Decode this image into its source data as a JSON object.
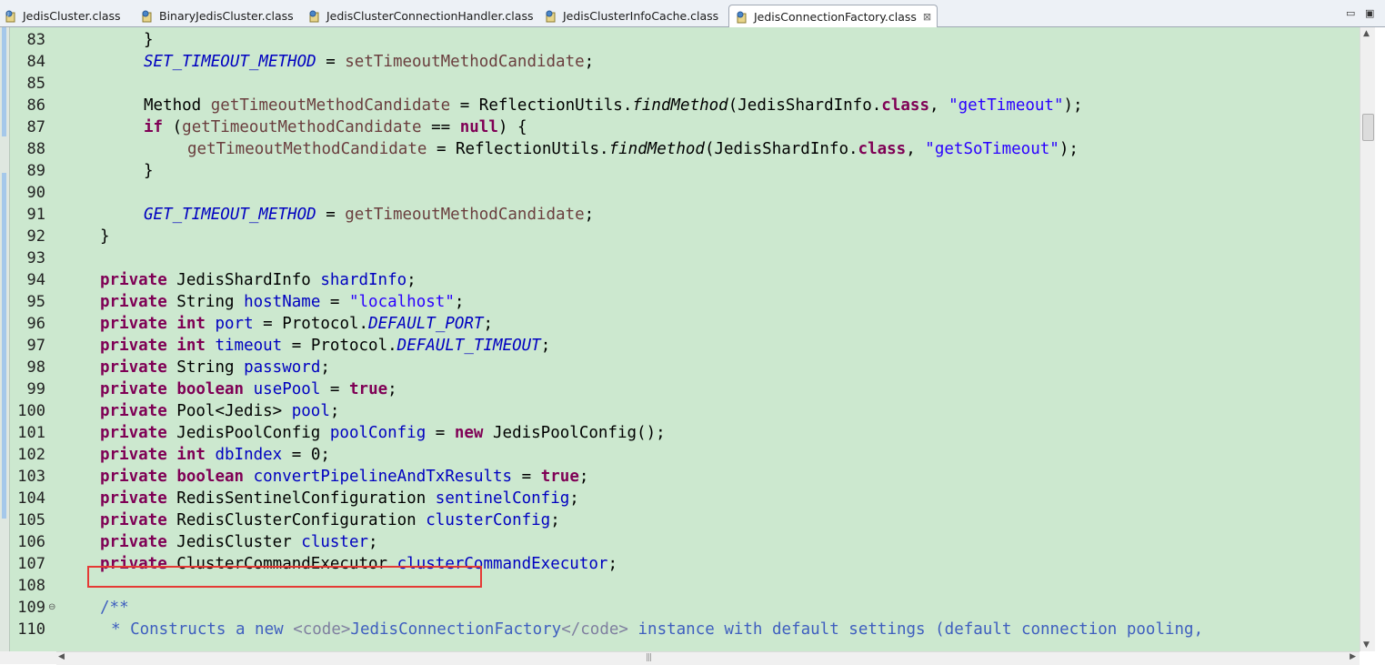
{
  "tabs": [
    {
      "label": "JedisCluster.class",
      "active": false
    },
    {
      "label": "BinaryJedisCluster.class",
      "active": false
    },
    {
      "label": "JedisClusterConnectionHandler.class",
      "active": false
    },
    {
      "label": "JedisClusterInfoCache.class",
      "active": false
    },
    {
      "label": "JedisConnectionFactory.class",
      "active": true
    }
  ],
  "window_controls": {
    "minimize": "▭",
    "maximize": "▣"
  },
  "close_glyph": "⊠",
  "colors": {
    "editor_bg": "#cce8cf",
    "keyword": "#7f0055",
    "field": "#0000c0",
    "string": "#2a00ff",
    "javadoc": "#3f5fbf",
    "highlight_box": "#e53935"
  },
  "code": {
    "lines": [
      {
        "num": "83",
        "indent": 8,
        "tokens": [
          {
            "t": "}",
            "c": ""
          }
        ]
      },
      {
        "num": "84",
        "indent": 8,
        "tokens": [
          {
            "t": "SET_TIMEOUT_METHOD",
            "c": "sfld"
          },
          {
            "t": " = ",
            "c": ""
          },
          {
            "t": "setTimeoutMethodCandidate",
            "c": "lv"
          },
          {
            "t": ";",
            "c": ""
          }
        ]
      },
      {
        "num": "85",
        "indent": 0,
        "tokens": []
      },
      {
        "num": "86",
        "indent": 8,
        "tokens": [
          {
            "t": "Method ",
            "c": ""
          },
          {
            "t": "getTimeoutMethodCandidate",
            "c": "lv"
          },
          {
            "t": " = ReflectionUtils.",
            "c": ""
          },
          {
            "t": "findMethod",
            "c": "it"
          },
          {
            "t": "(JedisShardInfo.",
            "c": ""
          },
          {
            "t": "class",
            "c": "kw"
          },
          {
            "t": ", ",
            "c": ""
          },
          {
            "t": "\"getTimeout\"",
            "c": "str"
          },
          {
            "t": ");",
            "c": ""
          }
        ]
      },
      {
        "num": "87",
        "indent": 8,
        "tokens": [
          {
            "t": "if",
            "c": "kw"
          },
          {
            "t": " (",
            "c": ""
          },
          {
            "t": "getTimeoutMethodCandidate",
            "c": "lv"
          },
          {
            "t": " == ",
            "c": ""
          },
          {
            "t": "null",
            "c": "kw"
          },
          {
            "t": ") {",
            "c": ""
          }
        ]
      },
      {
        "num": "88",
        "indent": 12,
        "tokens": [
          {
            "t": "getTimeoutMethodCandidate",
            "c": "lv"
          },
          {
            "t": " = ReflectionUtils.",
            "c": ""
          },
          {
            "t": "findMethod",
            "c": "it"
          },
          {
            "t": "(JedisShardInfo.",
            "c": ""
          },
          {
            "t": "class",
            "c": "kw"
          },
          {
            "t": ", ",
            "c": ""
          },
          {
            "t": "\"getSoTimeout\"",
            "c": "str"
          },
          {
            "t": ");",
            "c": ""
          }
        ]
      },
      {
        "num": "89",
        "indent": 8,
        "tokens": [
          {
            "t": "}",
            "c": ""
          }
        ]
      },
      {
        "num": "90",
        "indent": 0,
        "tokens": []
      },
      {
        "num": "91",
        "indent": 8,
        "tokens": [
          {
            "t": "GET_TIMEOUT_METHOD",
            "c": "sfld"
          },
          {
            "t": " = ",
            "c": ""
          },
          {
            "t": "getTimeoutMethodCandidate",
            "c": "lv"
          },
          {
            "t": ";",
            "c": ""
          }
        ]
      },
      {
        "num": "92",
        "indent": 4,
        "tokens": [
          {
            "t": "}",
            "c": ""
          }
        ]
      },
      {
        "num": "93",
        "indent": 0,
        "tokens": []
      },
      {
        "num": "94",
        "indent": 4,
        "tokens": [
          {
            "t": "private",
            "c": "kw"
          },
          {
            "t": " JedisShardInfo ",
            "c": ""
          },
          {
            "t": "shardInfo",
            "c": "fld"
          },
          {
            "t": ";",
            "c": ""
          }
        ]
      },
      {
        "num": "95",
        "indent": 4,
        "tokens": [
          {
            "t": "private",
            "c": "kw"
          },
          {
            "t": " String ",
            "c": ""
          },
          {
            "t": "hostName",
            "c": "fld"
          },
          {
            "t": " = ",
            "c": ""
          },
          {
            "t": "\"localhost\"",
            "c": "str"
          },
          {
            "t": ";",
            "c": ""
          }
        ]
      },
      {
        "num": "96",
        "indent": 4,
        "tokens": [
          {
            "t": "private",
            "c": "kw"
          },
          {
            "t": " ",
            "c": ""
          },
          {
            "t": "int",
            "c": "kw"
          },
          {
            "t": " ",
            "c": ""
          },
          {
            "t": "port",
            "c": "fld"
          },
          {
            "t": " = Protocol.",
            "c": ""
          },
          {
            "t": "DEFAULT_PORT",
            "c": "sfld"
          },
          {
            "t": ";",
            "c": ""
          }
        ]
      },
      {
        "num": "97",
        "indent": 4,
        "tokens": [
          {
            "t": "private",
            "c": "kw"
          },
          {
            "t": " ",
            "c": ""
          },
          {
            "t": "int",
            "c": "kw"
          },
          {
            "t": " ",
            "c": ""
          },
          {
            "t": "timeout",
            "c": "fld"
          },
          {
            "t": " = Protocol.",
            "c": ""
          },
          {
            "t": "DEFAULT_TIMEOUT",
            "c": "sfld"
          },
          {
            "t": ";",
            "c": ""
          }
        ]
      },
      {
        "num": "98",
        "indent": 4,
        "tokens": [
          {
            "t": "private",
            "c": "kw"
          },
          {
            "t": " String ",
            "c": ""
          },
          {
            "t": "password",
            "c": "fld"
          },
          {
            "t": ";",
            "c": ""
          }
        ]
      },
      {
        "num": "99",
        "indent": 4,
        "tokens": [
          {
            "t": "private",
            "c": "kw"
          },
          {
            "t": " ",
            "c": ""
          },
          {
            "t": "boolean",
            "c": "kw"
          },
          {
            "t": " ",
            "c": ""
          },
          {
            "t": "usePool",
            "c": "fld"
          },
          {
            "t": " = ",
            "c": ""
          },
          {
            "t": "true",
            "c": "kw"
          },
          {
            "t": ";",
            "c": ""
          }
        ]
      },
      {
        "num": "100",
        "indent": 4,
        "tokens": [
          {
            "t": "private",
            "c": "kw"
          },
          {
            "t": " Pool<Jedis> ",
            "c": ""
          },
          {
            "t": "pool",
            "c": "fld"
          },
          {
            "t": ";",
            "c": ""
          }
        ]
      },
      {
        "num": "101",
        "indent": 4,
        "tokens": [
          {
            "t": "private",
            "c": "kw"
          },
          {
            "t": " JedisPoolConfig ",
            "c": ""
          },
          {
            "t": "poolConfig",
            "c": "fld"
          },
          {
            "t": " = ",
            "c": ""
          },
          {
            "t": "new",
            "c": "kw"
          },
          {
            "t": " JedisPoolConfig();",
            "c": ""
          }
        ]
      },
      {
        "num": "102",
        "indent": 4,
        "tokens": [
          {
            "t": "private",
            "c": "kw"
          },
          {
            "t": " ",
            "c": ""
          },
          {
            "t": "int",
            "c": "kw"
          },
          {
            "t": " ",
            "c": ""
          },
          {
            "t": "dbIndex",
            "c": "fld"
          },
          {
            "t": " = 0;",
            "c": ""
          }
        ]
      },
      {
        "num": "103",
        "indent": 4,
        "tokens": [
          {
            "t": "private",
            "c": "kw"
          },
          {
            "t": " ",
            "c": ""
          },
          {
            "t": "boolean",
            "c": "kw"
          },
          {
            "t": " ",
            "c": ""
          },
          {
            "t": "convertPipelineAndTxResults",
            "c": "fld"
          },
          {
            "t": " = ",
            "c": ""
          },
          {
            "t": "true",
            "c": "kw"
          },
          {
            "t": ";",
            "c": ""
          }
        ]
      },
      {
        "num": "104",
        "indent": 4,
        "tokens": [
          {
            "t": "private",
            "c": "kw"
          },
          {
            "t": " RedisSentinelConfiguration ",
            "c": ""
          },
          {
            "t": "sentinelConfig",
            "c": "fld"
          },
          {
            "t": ";",
            "c": ""
          }
        ]
      },
      {
        "num": "105",
        "indent": 4,
        "tokens": [
          {
            "t": "private",
            "c": "kw"
          },
          {
            "t": " RedisClusterConfiguration ",
            "c": ""
          },
          {
            "t": "clusterConfig",
            "c": "fld"
          },
          {
            "t": ";",
            "c": ""
          }
        ]
      },
      {
        "num": "106",
        "indent": 4,
        "tokens": [
          {
            "t": "private",
            "c": "kw"
          },
          {
            "t": " JedisCluster ",
            "c": ""
          },
          {
            "t": "cluster",
            "c": "fld"
          },
          {
            "t": ";",
            "c": ""
          }
        ]
      },
      {
        "num": "107",
        "indent": 4,
        "tokens": [
          {
            "t": "private",
            "c": "kw"
          },
          {
            "t": " ClusterCommandExecutor ",
            "c": ""
          },
          {
            "t": "clusterCommandExecutor",
            "c": "fld"
          },
          {
            "t": ";",
            "c": ""
          }
        ]
      },
      {
        "num": "108",
        "indent": 0,
        "tokens": []
      },
      {
        "num": "109",
        "indent": 4,
        "fold": "⊖",
        "tokens": [
          {
            "t": "/**",
            "c": "jd"
          }
        ]
      },
      {
        "num": "110",
        "indent": 5,
        "tokens": [
          {
            "t": "* Constructs a new ",
            "c": "jd"
          },
          {
            "t": "<code>",
            "c": "jdt"
          },
          {
            "t": "JedisConnectionFactory",
            "c": "jd"
          },
          {
            "t": "</code>",
            "c": "jdt"
          },
          {
            "t": " instance with default settings (default connection pooling,",
            "c": "jd"
          }
        ]
      }
    ]
  }
}
